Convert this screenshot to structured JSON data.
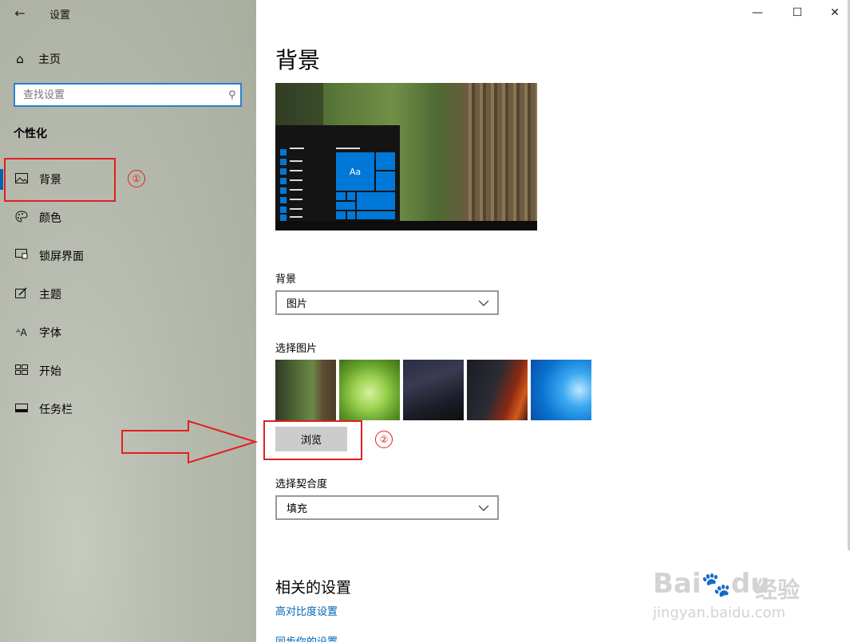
{
  "window": {
    "title": "设置"
  },
  "sidebar": {
    "home_label": "主页",
    "search_placeholder": "查找设置",
    "section_title": "个性化",
    "items": [
      {
        "label": "背景",
        "icon": "picture-icon",
        "selected": true
      },
      {
        "label": "颜色",
        "icon": "palette-icon"
      },
      {
        "label": "锁屏界面",
        "icon": "lockscreen-icon"
      },
      {
        "label": "主题",
        "icon": "brush-icon"
      },
      {
        "label": "字体",
        "icon": "font-icon"
      },
      {
        "label": "开始",
        "icon": "start-icon"
      },
      {
        "label": "任务栏",
        "icon": "taskbar-icon"
      }
    ]
  },
  "main": {
    "title": "背景",
    "preview_tile_text": "Aa",
    "background_label": "背景",
    "background_value": "图片",
    "choose_picture_label": "选择图片",
    "browse_label": "浏览",
    "fit_label": "选择契合度",
    "fit_value": "填充",
    "related_title": "相关的设置",
    "related_links": [
      "高对比度设置",
      "同步你的设置"
    ]
  },
  "annotations": {
    "marker_1": "①",
    "marker_2": "②",
    "color": "#e02020"
  },
  "watermark": {
    "brand": "Bai",
    "brand_suffix": "du",
    "brand_cn": "经验",
    "url": "jingyan.baidu.com"
  },
  "colors": {
    "accent": "#0078d7",
    "link": "#0067b8",
    "selection_bar": "#0063b1"
  }
}
